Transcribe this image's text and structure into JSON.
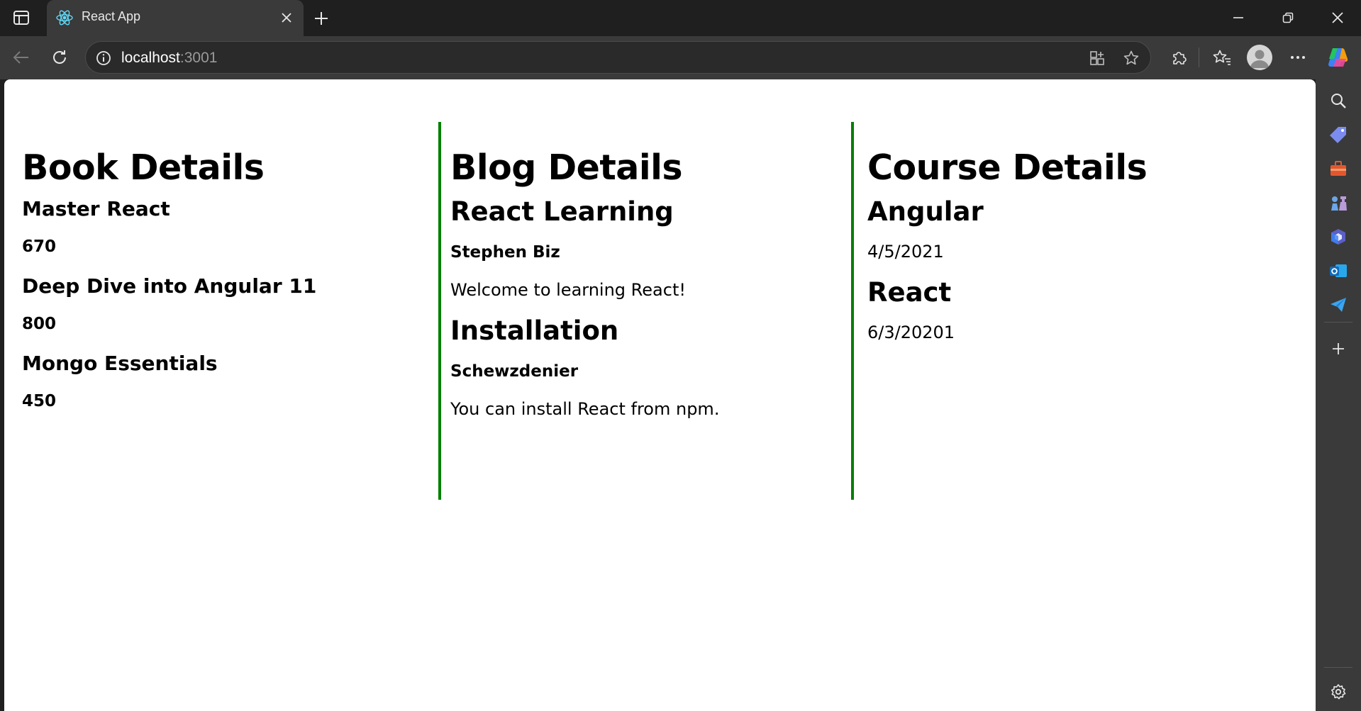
{
  "browser": {
    "tab": {
      "title": "React App",
      "favicon": "react-logo-icon"
    },
    "address": {
      "host": "localhost",
      "port": ":3001"
    },
    "icons": {
      "tab_actions": "tab-actions-icon",
      "close": "close-icon",
      "new_tab": "plus-icon",
      "back": "back-arrow-icon",
      "reload": "reload-icon",
      "info": "info-icon",
      "apps": "app-install-icon",
      "favorite": "star-icon",
      "extensions": "puzzle-icon",
      "favorites": "favorites-icon",
      "profile": "profile-icon",
      "more": "more-icon",
      "copilot": "copilot-icon"
    },
    "accent": "#008000"
  },
  "sidebar": {
    "items": [
      "search-icon",
      "tag-icon",
      "toolbox-icon",
      "chess-icon",
      "copilot-m365-icon",
      "outlook-icon",
      "send-icon",
      "plus-icon",
      "settings-icon"
    ]
  },
  "page": {
    "book": {
      "title": "Book Details",
      "items": [
        {
          "name": "Master React",
          "price": "670"
        },
        {
          "name": "Deep Dive into Angular 11",
          "price": "800"
        },
        {
          "name": "Mongo Essentials",
          "price": "450"
        }
      ]
    },
    "blog": {
      "title": "Blog Details",
      "items": [
        {
          "title": "React Learning",
          "author": "Stephen Biz",
          "content": "Welcome to learning React!"
        },
        {
          "title": "Installation",
          "author": "Schewzdenier",
          "content": "You can install React from npm."
        }
      ]
    },
    "course": {
      "title": "Course Details",
      "items": [
        {
          "name": "Angular",
          "date": "4/5/2021"
        },
        {
          "name": "React",
          "date": "6/3/20201"
        }
      ]
    }
  }
}
